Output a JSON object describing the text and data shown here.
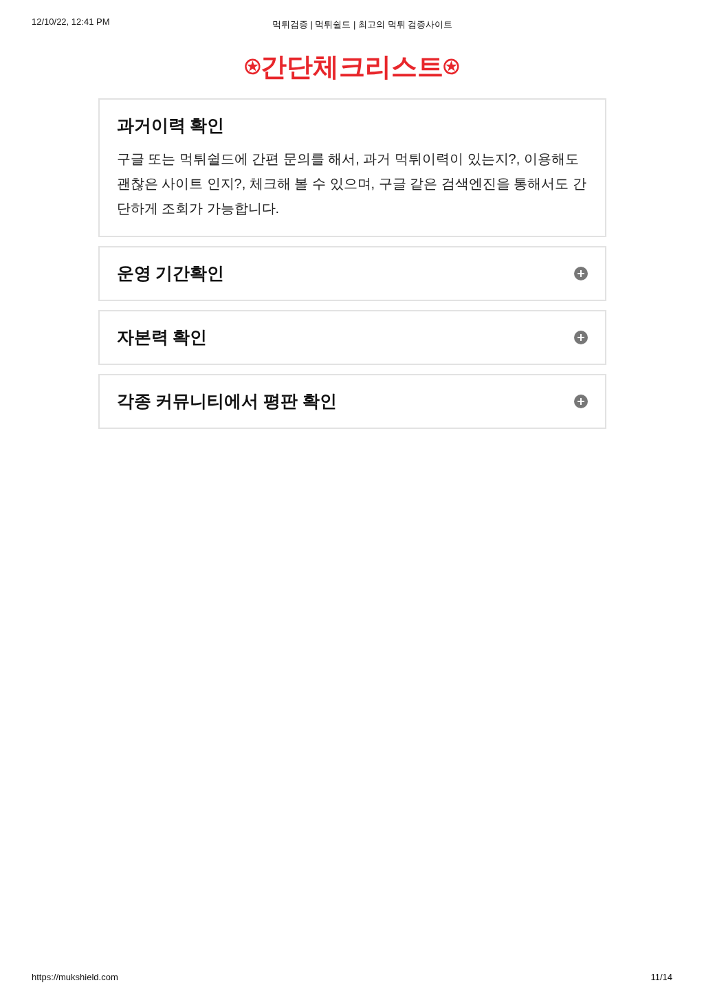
{
  "print_header": {
    "date": "12/10/22, 12:41 PM",
    "page_title": "먹튀검증 | 먹튀쉴드 | 최고의 먹튀 검증사이트"
  },
  "heading": "⍟간단체크리스트⍟",
  "accordion": [
    {
      "title": "과거이력 확인",
      "expanded": true,
      "body": "구글 또는 먹튀쉴드에 간편 문의를 해서, 과거 먹튀이력이 있는지?, 이용해도괜찮은 사이트 인지?, 체크해 볼 수 있으며, 구글 같은 검색엔진을 통해서도 간단하게 조회가 가능합니다."
    },
    {
      "title": "운영 기간확인",
      "expanded": false
    },
    {
      "title": "자본력 확인",
      "expanded": false
    },
    {
      "title": "각종 커뮤니티에서 평판 확인",
      "expanded": false
    }
  ],
  "print_footer": {
    "url": "https://mukshield.com",
    "page": "11/14"
  }
}
